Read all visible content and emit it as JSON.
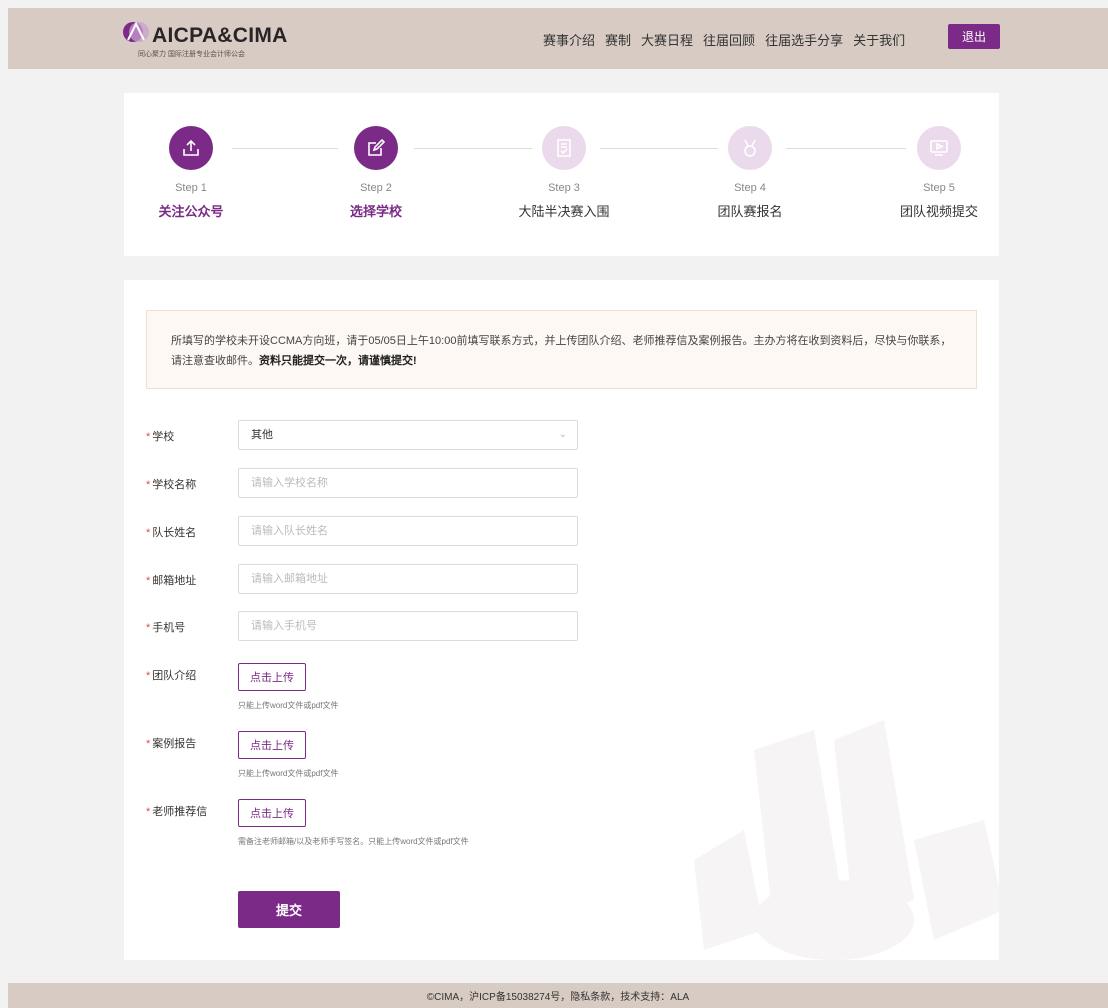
{
  "brand": {
    "logo_text": "AICPA&CIMA",
    "logo_sub": "同心聚力  国际注册专业会计师公会"
  },
  "nav": {
    "items": [
      "赛事介绍",
      "赛制",
      "大赛日程",
      "往届回顾",
      "往届选手分享",
      "关于我们"
    ],
    "logout": "退出"
  },
  "steps": [
    {
      "num": "Step 1",
      "title": "关注公众号",
      "icon": "upload-icon",
      "active": true
    },
    {
      "num": "Step 2",
      "title": "选择学校",
      "icon": "edit-icon",
      "active": true
    },
    {
      "num": "Step 3",
      "title": "大陆半决赛入围",
      "icon": "document-check-icon",
      "active": false
    },
    {
      "num": "Step 4",
      "title": "团队赛报名",
      "icon": "medal-icon",
      "active": false
    },
    {
      "num": "Step 5",
      "title": "团队视频提交",
      "icon": "video-icon",
      "active": false
    }
  ],
  "notice": {
    "text": "所填写的学校未开设CCMA方向班，请于05/05日上午10:00前填写联系方式，并上传团队介绍、老师推荐信及案例报告。主办方将在收到资料后，尽快与你联系，请注意查收邮件。",
    "bold": "资料只能提交一次，请谨慎提交!"
  },
  "form": {
    "required_mark": "*",
    "school": {
      "label": "学校",
      "value": "其他"
    },
    "school_name": {
      "label": "学校名称",
      "placeholder": "请输入学校名称"
    },
    "captain": {
      "label": "队长姓名",
      "placeholder": "请输入队长姓名"
    },
    "email": {
      "label": "邮箱地址",
      "placeholder": "请输入邮箱地址"
    },
    "phone": {
      "label": "手机号",
      "placeholder": "请输入手机号"
    },
    "team_intro": {
      "label": "团队介绍",
      "button": "点击上传",
      "hint": "只能上传word文件或pdf文件"
    },
    "case_report": {
      "label": "案例报告",
      "button": "点击上传",
      "hint": "只能上传word文件或pdf文件"
    },
    "teacher_letter": {
      "label": "老师推荐信",
      "button": "点击上传",
      "hint": "需备注老师邮箱/以及老师手写签名。只能上传word文件或pdf文件"
    },
    "submit": "提交"
  },
  "footer": {
    "text": "©CIMA，沪ICP备15038274号，隐私条款，技术支持：ALA"
  },
  "colors": {
    "accent": "#7b2a87",
    "accent_light": "#ebdaeb",
    "header_bg": "#d7cbc3",
    "page_bg": "#f2f2f3"
  }
}
